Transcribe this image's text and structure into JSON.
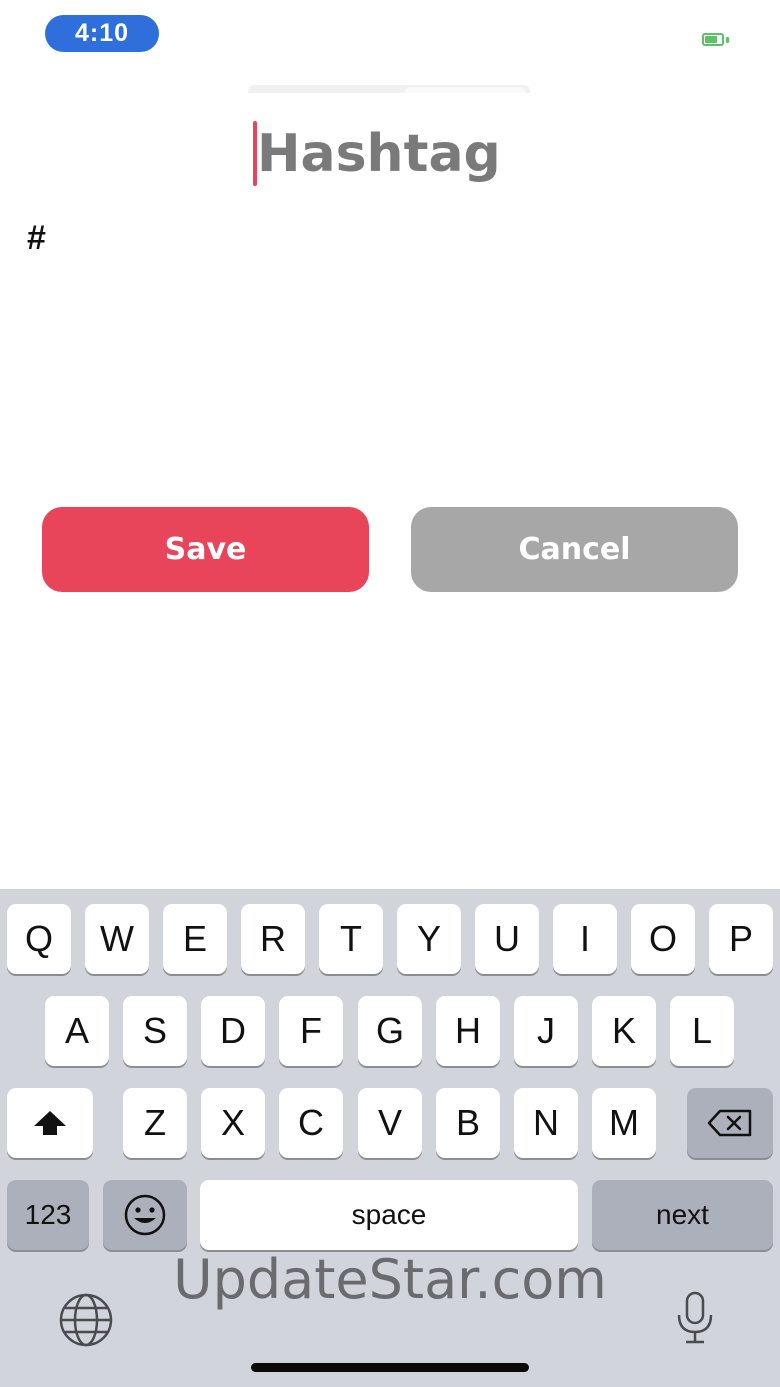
{
  "status": {
    "time": "4:10"
  },
  "form": {
    "title_placeholder": "Hashtag",
    "hash_symbol": "#",
    "save_label": "Save",
    "cancel_label": "Cancel"
  },
  "colors": {
    "accent": "#e8445a",
    "cancel": "#a7a7a7",
    "time_pill": "#2f6fdb"
  },
  "keyboard": {
    "row1": [
      "Q",
      "W",
      "E",
      "R",
      "T",
      "Y",
      "U",
      "I",
      "O",
      "P"
    ],
    "row2": [
      "A",
      "S",
      "D",
      "F",
      "G",
      "H",
      "J",
      "K",
      "L"
    ],
    "row3": [
      "Z",
      "X",
      "C",
      "V",
      "B",
      "N",
      "M"
    ],
    "numbers_label": "123",
    "space_label": "space",
    "next_label": "next"
  },
  "watermark": "UpdateStar.com"
}
